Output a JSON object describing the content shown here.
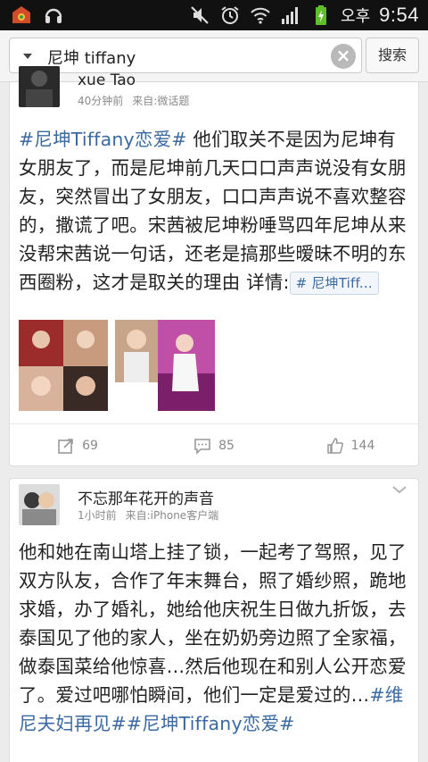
{
  "status_bar": {
    "icons": [
      "app-store-icon",
      "headset-icon",
      "mute-icon",
      "alarm-icon",
      "wifi-icon",
      "signal-icon",
      "battery-charging-icon"
    ],
    "ampm": "오후",
    "time": "9:54"
  },
  "search": {
    "query": "尼坤 tiffany",
    "button_label": "搜索"
  },
  "posts": [
    {
      "username": "xue Tao",
      "time": "40分钟前",
      "source": "来自:微话题",
      "text_parts": {
        "hashtag": "#尼坤Tiffany恋爱#",
        "body": " 他们取关不是因为尼坤有女朋友了，而是尼坤前几天口口声声说没有女朋友，突然冒出了女朋友，口口声声说不喜欢整容的，撒谎了吧。宋茜被尼坤粉唾骂四年尼坤从来没帮宋茜说一句话，还老是搞那些暧昧不明的东西圈粉，这才是取关的理由 详情:",
        "link_chip": "# 尼坤Tiff..."
      },
      "actions": {
        "repost_count": "69",
        "comment_count": "85",
        "like_count": "144"
      }
    },
    {
      "username": "不忘那年花开的声音",
      "time": "1小时前",
      "source": "来自:iPhone客户端",
      "text_parts": {
        "body": "他和她在南山塔上挂了锁，一起考了驾照，见了双方队友，合作了年末舞台，照了婚纱照，跪地求婚，办了婚礼，她给他庆祝生日做九折饭，去泰国见了他的家人，坐在奶奶旁边照了全家福，做泰国菜给他惊喜…然后他现在和别人公开恋爱了。爱过吧哪怕瞬间，他们一定是爱过的…",
        "hashtag1": "#维尼夫妇再见#",
        "hashtag2": "#尼坤Tiffany恋爱#"
      }
    }
  ],
  "colors": {
    "hashtag": "#3b6aa0",
    "status_bar_bg": "#111111",
    "page_bg": "#ececec"
  }
}
